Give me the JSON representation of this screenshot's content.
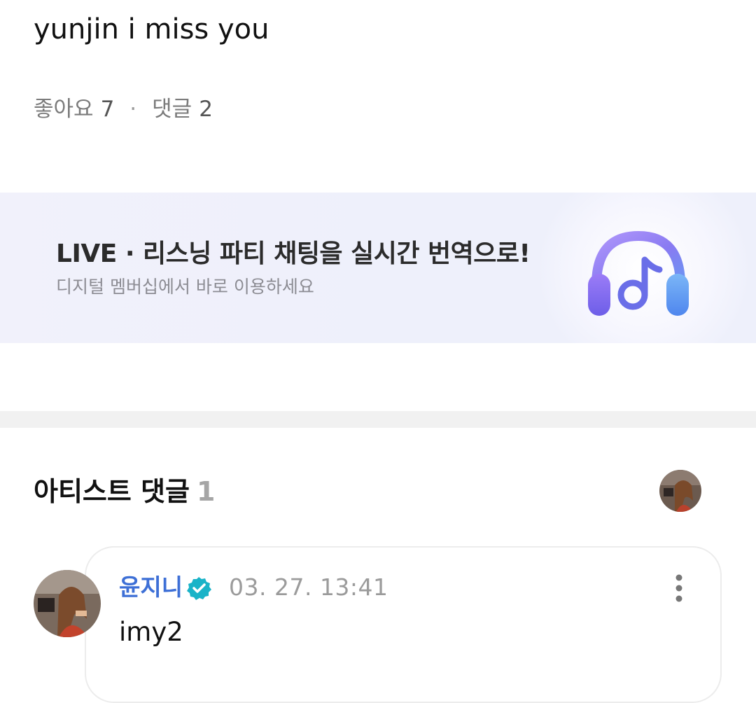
{
  "post": {
    "text": "yunjin i miss you",
    "likes_label": "좋아요",
    "likes_count": "7",
    "separator": "·",
    "comments_label": "댓글",
    "comments_count": "2"
  },
  "banner": {
    "title": "LIVE · 리스닝 파티 채팅을 실시간 번역으로!",
    "subtitle": "디지털 멤버십에서 바로 이용하세요",
    "icon": "headphones-music-icon"
  },
  "artist_comments": {
    "title": "아티스트 댓글",
    "count": "1",
    "avatar_icon": "artist-avatar"
  },
  "comment": {
    "author": "윤지니",
    "verified_icon": "verified-badge-icon",
    "timestamp": "03. 27. 13:41",
    "text": "imy2",
    "more_icon": "more-vertical-icon"
  },
  "colors": {
    "author_blue": "#3d6fd6",
    "verified_teal": "#19b3c8",
    "banner_bg": "#eef0fb"
  }
}
